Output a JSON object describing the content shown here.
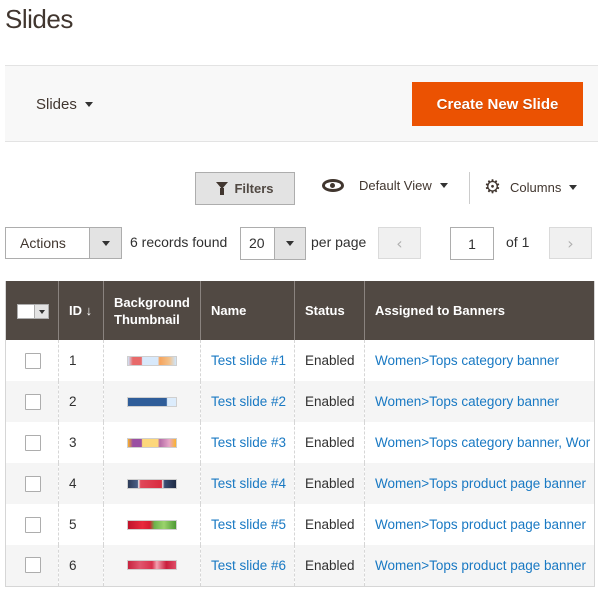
{
  "page": {
    "title": "Slides"
  },
  "page_actions": {
    "switcher_label": "Slides",
    "create_button": "Create New Slide",
    "accent_color": "#eb5202"
  },
  "toolbar": {
    "filters_label": "Filters",
    "view_label": "Default View",
    "columns_label": "Columns",
    "actions_label": "Actions",
    "records_found": "6 records found",
    "per_page_value": "20",
    "per_page_label": "per page",
    "prev_icon": "‹",
    "next_icon": "›",
    "current_page": "1",
    "page_total": "of 1"
  },
  "grid": {
    "columns": [
      {
        "key": "select",
        "label": ""
      },
      {
        "key": "id",
        "label": "ID ↓"
      },
      {
        "key": "thumbnail",
        "label": "Background Thumbnail"
      },
      {
        "key": "name",
        "label": "Name"
      },
      {
        "key": "status",
        "label": "Status"
      },
      {
        "key": "banners",
        "label": "Assigned to Banners"
      }
    ],
    "rows": [
      {
        "id": "1",
        "thumbnail": "banner-thumbnail-1",
        "name": "Test slide #1",
        "status": "Enabled",
        "banners": "Women>Tops category banner"
      },
      {
        "id": "2",
        "thumbnail": "banner-thumbnail-2",
        "name": "Test slide #2",
        "status": "Enabled",
        "banners": "Women>Tops category banner"
      },
      {
        "id": "3",
        "thumbnail": "banner-thumbnail-3",
        "name": "Test slide #3",
        "status": "Enabled",
        "banners": "Women>Tops category banner, Wor"
      },
      {
        "id": "4",
        "thumbnail": "berries-thumbnail",
        "name": "Test slide #4",
        "status": "Enabled",
        "banners": "Women>Tops product page banner"
      },
      {
        "id": "5",
        "thumbnail": "strawberries-thumbnail",
        "name": "Test slide #5",
        "status": "Enabled",
        "banners": "Women>Tops product page banner"
      },
      {
        "id": "6",
        "thumbnail": "raspberries-thumbnail",
        "name": "Test slide #6",
        "status": "Enabled",
        "banners": "Women>Tops product page banner"
      }
    ]
  }
}
